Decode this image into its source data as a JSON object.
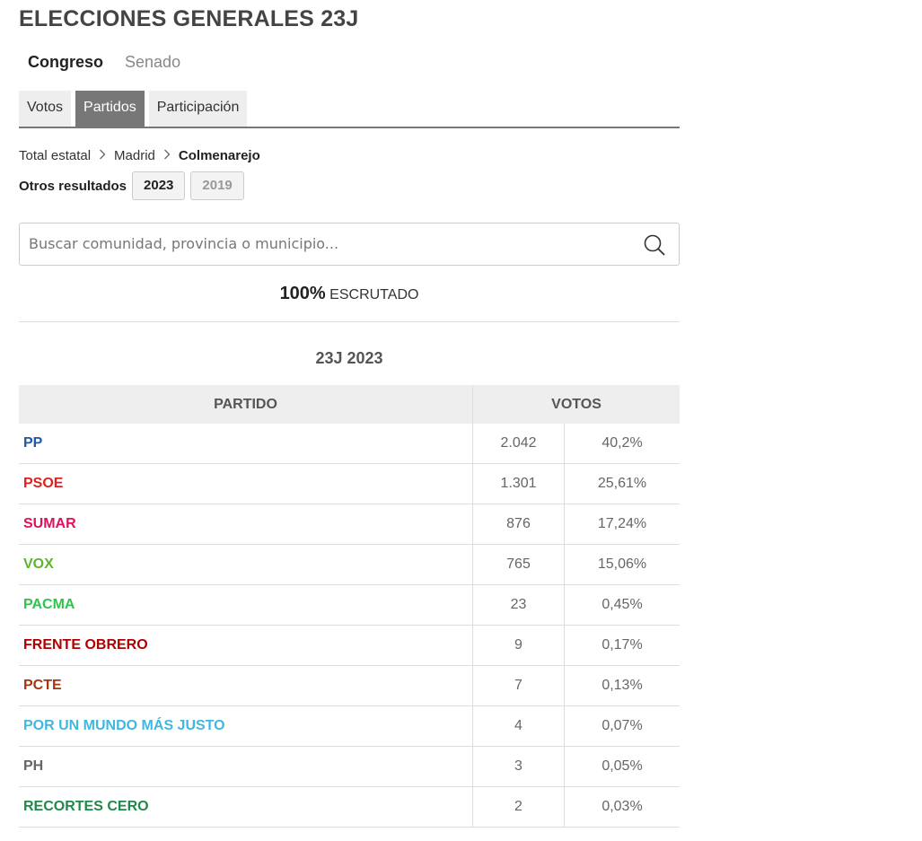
{
  "header": {
    "title": "ELECCIONES GENERALES 23J"
  },
  "chambers": {
    "active": "Congreso",
    "inactive": "Senado"
  },
  "tabs": [
    {
      "label": "Votos",
      "selected": false
    },
    {
      "label": "Partidos",
      "selected": true
    },
    {
      "label": "Participación",
      "selected": false
    }
  ],
  "breadcrumb": {
    "level1": "Total estatal",
    "level2": "Madrid",
    "current": "Colmenarejo"
  },
  "other_results": {
    "label": "Otros resultados",
    "year_active": "2023",
    "year_inactive": "2019"
  },
  "search": {
    "placeholder": "Buscar comunidad, provincia o municipio...",
    "value": ""
  },
  "counted": {
    "percent": "100%",
    "label": "ESCRUTADO"
  },
  "results_table": {
    "title": "23J 2023",
    "headers": {
      "party": "PARTIDO",
      "votes": "VOTOS"
    },
    "rows": [
      {
        "party": "PP",
        "votes": "2.042",
        "share": "40,2%",
        "color": "#1a5aa8"
      },
      {
        "party": "PSOE",
        "votes": "1.301",
        "share": "25,61%",
        "color": "#e02020"
      },
      {
        "party": "SUMAR",
        "votes": "876",
        "share": "17,24%",
        "color": "#e0115f"
      },
      {
        "party": "VOX",
        "votes": "765",
        "share": "15,06%",
        "color": "#5fb52e"
      },
      {
        "party": "PACMA",
        "votes": "23",
        "share": "0,45%",
        "color": "#2fc44d"
      },
      {
        "party": "FRENTE OBRERO",
        "votes": "9",
        "share": "0,17%",
        "color": "#b00000"
      },
      {
        "party": "PCTE",
        "votes": "7",
        "share": "0,13%",
        "color": "#a5360f"
      },
      {
        "party": "POR UN MUNDO MÁS JUSTO",
        "votes": "4",
        "share": "0,07%",
        "color": "#3fb8e0"
      },
      {
        "party": "PH",
        "votes": "3",
        "share": "0,05%",
        "color": "#666666"
      },
      {
        "party": "RECORTES CERO",
        "votes": "2",
        "share": "0,03%",
        "color": "#1e8a4a"
      }
    ]
  }
}
